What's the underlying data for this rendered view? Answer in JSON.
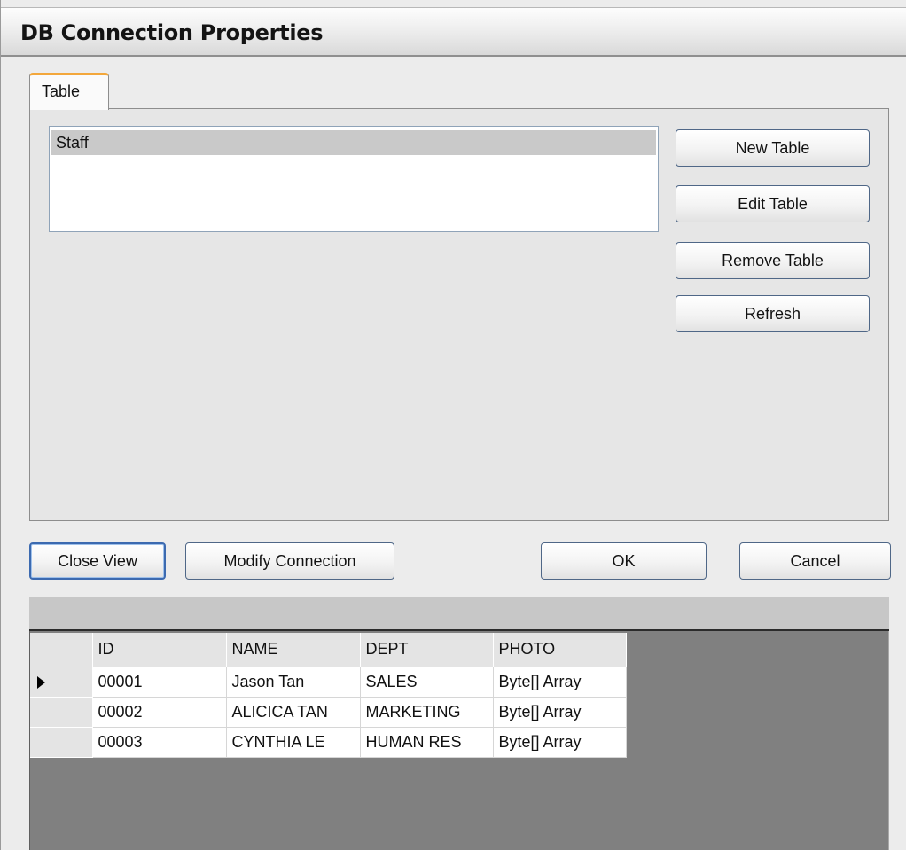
{
  "window": {
    "title": "DB Connection Properties"
  },
  "tabs": [
    {
      "label": "Table",
      "selected": true
    }
  ],
  "table_list": {
    "items": [
      "Staff"
    ],
    "selected_index": 0
  },
  "side_buttons": {
    "new_table": "New Table",
    "edit_table": "Edit Table",
    "remove_table": "Remove Table",
    "refresh": "Refresh"
  },
  "bottom_buttons": {
    "close_view": "Close View",
    "modify_connection": "Modify Connection",
    "ok": "OK",
    "cancel": "Cancel"
  },
  "grid": {
    "columns": [
      "ID",
      "NAME",
      "DEPT",
      "PHOTO"
    ],
    "rows": [
      {
        "current": true,
        "cells": [
          "00001",
          "Jason Tan",
          "SALES",
          "Byte[] Array"
        ]
      },
      {
        "current": false,
        "cells": [
          "00002",
          "ALICICA TAN",
          "MARKETING",
          "Byte[] Array"
        ]
      },
      {
        "current": false,
        "cells": [
          "00003",
          "CYNTHIA LE",
          "HUMAN RES",
          "Byte[] Array"
        ]
      }
    ]
  },
  "colors": {
    "tab_accent": "#f3a73b",
    "button_border": "#4f6787",
    "grid_background": "#808080",
    "list_selection": "#c9c9c9"
  }
}
